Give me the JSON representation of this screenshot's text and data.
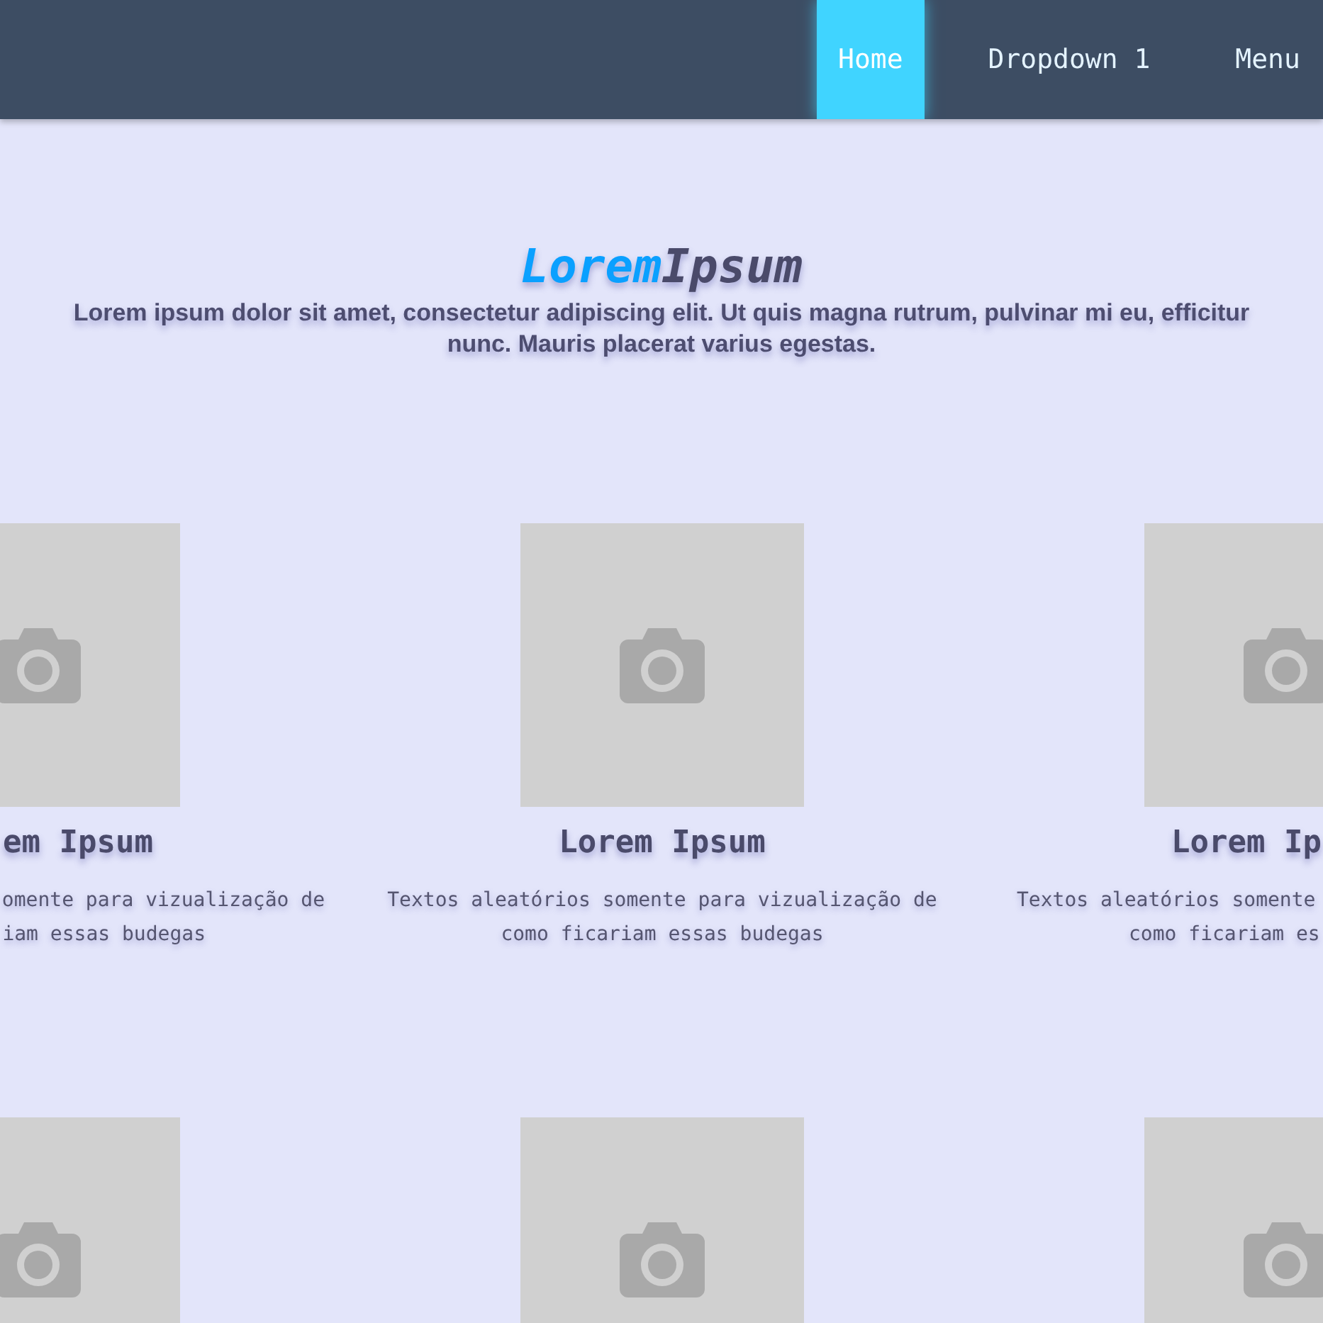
{
  "nav": [
    {
      "label": "Home",
      "selected": true
    },
    {
      "label": "Dropdown 1",
      "selected": false
    },
    {
      "label": "Menu",
      "selected": false
    }
  ],
  "hero": {
    "title_accent": "Lorem",
    "title_rest": "Ipsum",
    "subtitle": "Lorem ipsum dolor sit amet, consectetur adipiscing elit. Ut quis magna rutrum, pulvinar mi eu, efficitur nunc. Mauris placerat varius egestas."
  },
  "cards": [
    {
      "kind": "left-cut",
      "title": "em Ipsum",
      "lines": [
        "omente para vizualização de",
        "iam essas budegas"
      ]
    },
    {
      "kind": "whole",
      "title": "Lorem Ipsum",
      "lines": [
        "Textos aleatórios somente para vizualização de",
        "como ficariam essas budegas"
      ]
    },
    {
      "kind": "right-cut",
      "title": "Lorem Ip",
      "lines": [
        "Textos aleatórios somente",
        "como ficariam es"
      ]
    },
    {
      "kind": "image-only"
    },
    {
      "kind": "image-only"
    },
    {
      "kind": "image-only"
    }
  ]
}
